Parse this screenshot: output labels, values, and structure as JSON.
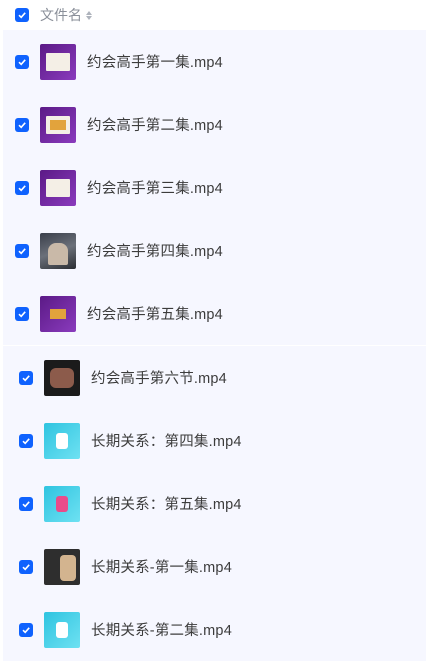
{
  "header": {
    "column_label": "文件名",
    "sort_icon": "sort-icon"
  },
  "files": [
    {
      "name": "约会高手第一集.mp4",
      "thumb": "purple"
    },
    {
      "name": "约会高手第二集.mp4",
      "thumb": "purple"
    },
    {
      "name": "约会高手第三集.mp4",
      "thumb": "purple"
    },
    {
      "name": "约会高手第四集.mp4",
      "thumb": "dark"
    },
    {
      "name": "约会高手第五集.mp4",
      "thumb": "purple"
    },
    {
      "name": "约会高手第六节.mp4",
      "thumb": "black"
    },
    {
      "name": "长期关系：第四集.mp4",
      "thumb": "cyan"
    },
    {
      "name": "长期关系：第五集.mp4",
      "thumb": "cyan2"
    },
    {
      "name": "长期关系-第一集.mp4",
      "thumb": "gray"
    },
    {
      "name": "长期关系-第二集.mp4",
      "thumb": "cyan"
    }
  ],
  "colors": {
    "checkbox": "#0f62fe",
    "row_bg": "#f6f7ff"
  }
}
